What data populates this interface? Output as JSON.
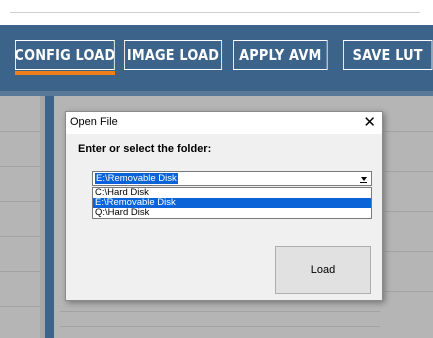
{
  "toolbar": {
    "buttons": [
      {
        "label": "CONFIG LOAD",
        "active": true
      },
      {
        "label": "IMAGE LOAD"
      },
      {
        "label": "APPLY AVM"
      },
      {
        "label": "SAVE LUT"
      }
    ],
    "accent_color": "#f07e1a",
    "background_color": "#3c638a"
  },
  "dialog": {
    "title": "Open File",
    "close_icon": "close-icon",
    "prompt": "Enter or select the folder:",
    "combo": {
      "value": "E:\\Removable Disk",
      "arrow_icon": "chevron-down-icon"
    },
    "options": [
      {
        "label": "C:\\Hard Disk",
        "selected": false
      },
      {
        "label": "E:\\Removable Disk",
        "selected": true
      },
      {
        "label": "Q:\\Hard Disk",
        "selected": false
      }
    ],
    "load_label": "Load"
  }
}
